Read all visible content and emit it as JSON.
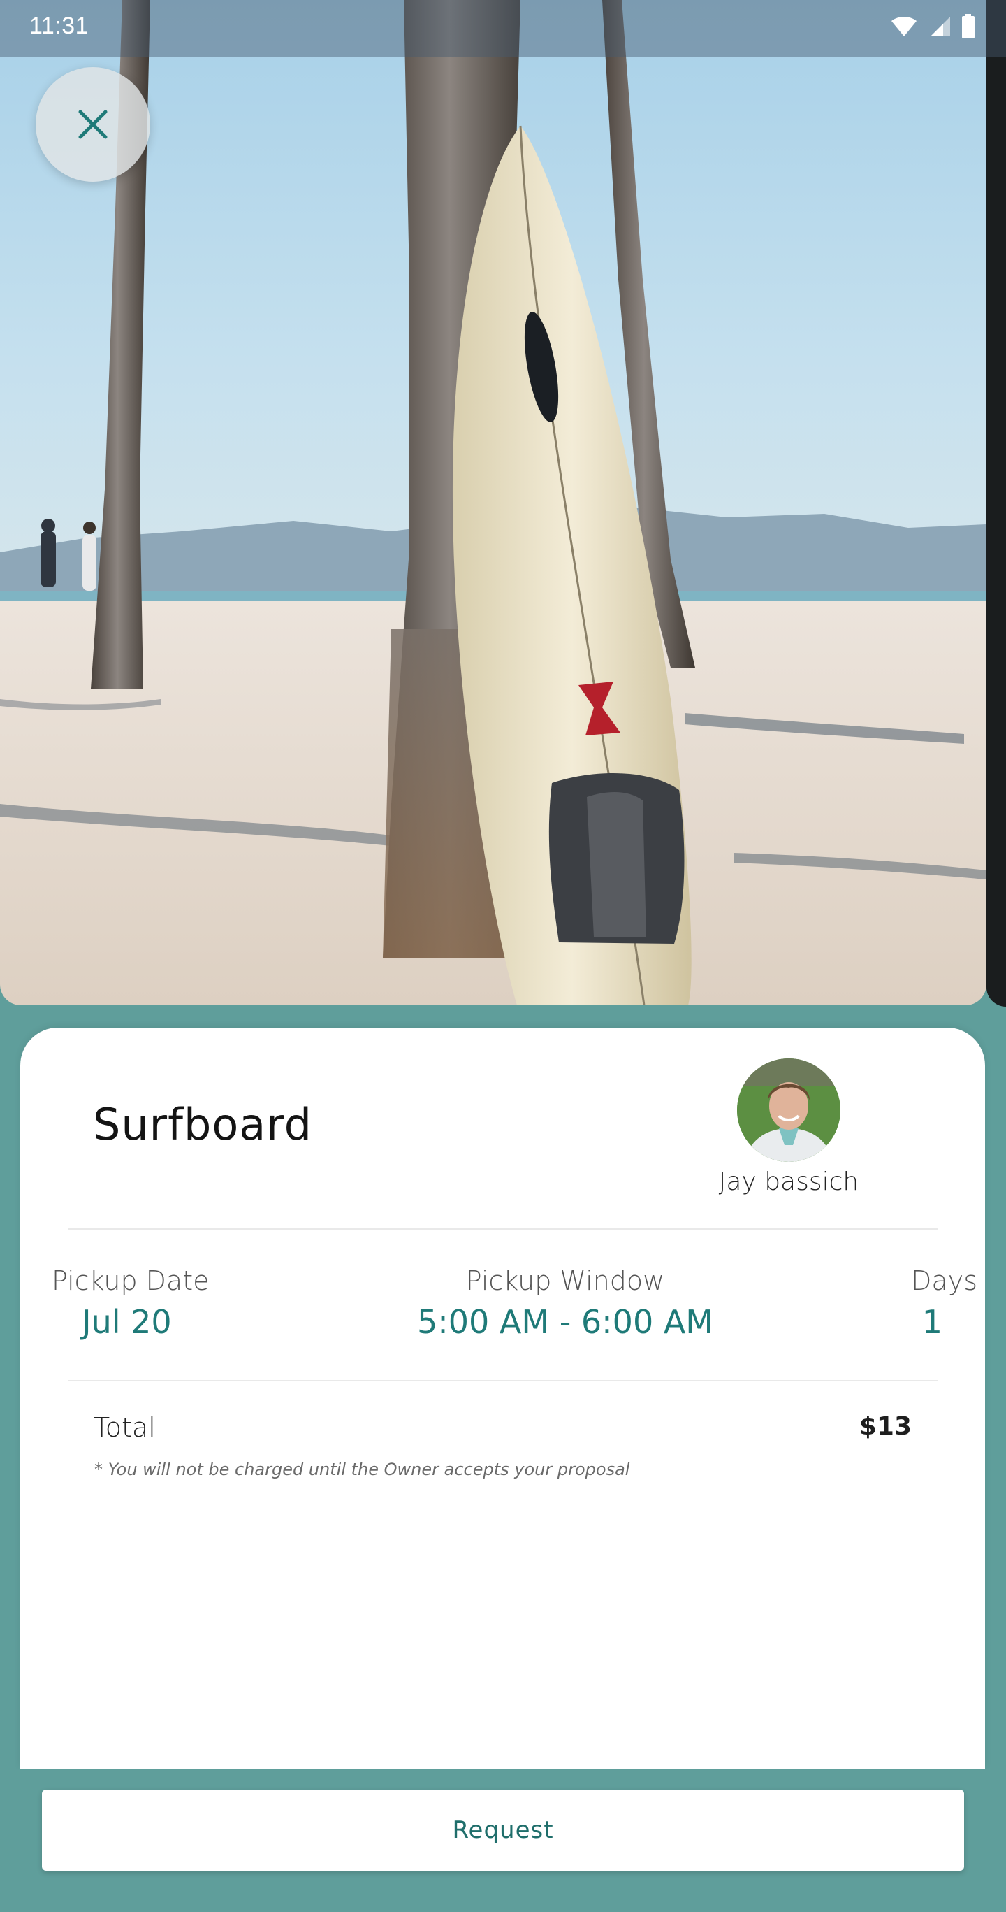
{
  "status_bar": {
    "time": "11:31",
    "icons": [
      "wifi-icon",
      "cellular-signal-icon",
      "battery-icon"
    ]
  },
  "hero": {
    "image": "surfboard-leaning-on-palm-tree-on-beach",
    "close_icon": "close-icon"
  },
  "listing": {
    "title": "Surfboard",
    "owner_name": "Jay bassich",
    "owner_avatar": "avatar-photo"
  },
  "details": {
    "pickup_date_label": "Pickup Date",
    "pickup_date_value": "Jul 20",
    "pickup_window_label": "Pickup Window",
    "pickup_window_value": "5:00 AM - 6:00 AM",
    "days_label": "Days",
    "days_value": "1"
  },
  "pricing": {
    "total_label": "Total",
    "total_value": "$13",
    "note": "* You will not be charged until the Owner accepts your proposal"
  },
  "actions": {
    "request_label": "Request"
  },
  "colors": {
    "accent": "#1f7a78",
    "background": "#5f9e9b",
    "card": "#ffffff"
  }
}
